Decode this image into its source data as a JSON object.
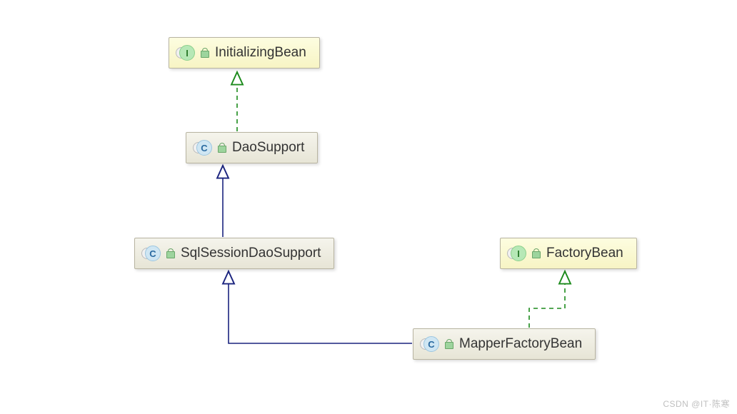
{
  "nodes": {
    "initializingBean": {
      "label": "InitializingBean",
      "type": "interface"
    },
    "daoSupport": {
      "label": "DaoSupport",
      "type": "class"
    },
    "sqlSessionDaoSupport": {
      "label": "SqlSessionDaoSupport",
      "type": "class"
    },
    "factoryBean": {
      "label": "FactoryBean",
      "type": "interface"
    },
    "mapperFactoryBean": {
      "label": "MapperFactoryBean",
      "type": "class"
    }
  },
  "edges": [
    {
      "from": "daoSupport",
      "to": "initializingBean",
      "kind": "implements"
    },
    {
      "from": "sqlSessionDaoSupport",
      "to": "daoSupport",
      "kind": "extends"
    },
    {
      "from": "mapperFactoryBean",
      "to": "sqlSessionDaoSupport",
      "kind": "extends"
    },
    {
      "from": "mapperFactoryBean",
      "to": "factoryBean",
      "kind": "implements"
    }
  ],
  "colors": {
    "extends": "#1a237e",
    "implements": "#1b8a1b"
  },
  "watermark": "CSDN @IT·陈寒"
}
